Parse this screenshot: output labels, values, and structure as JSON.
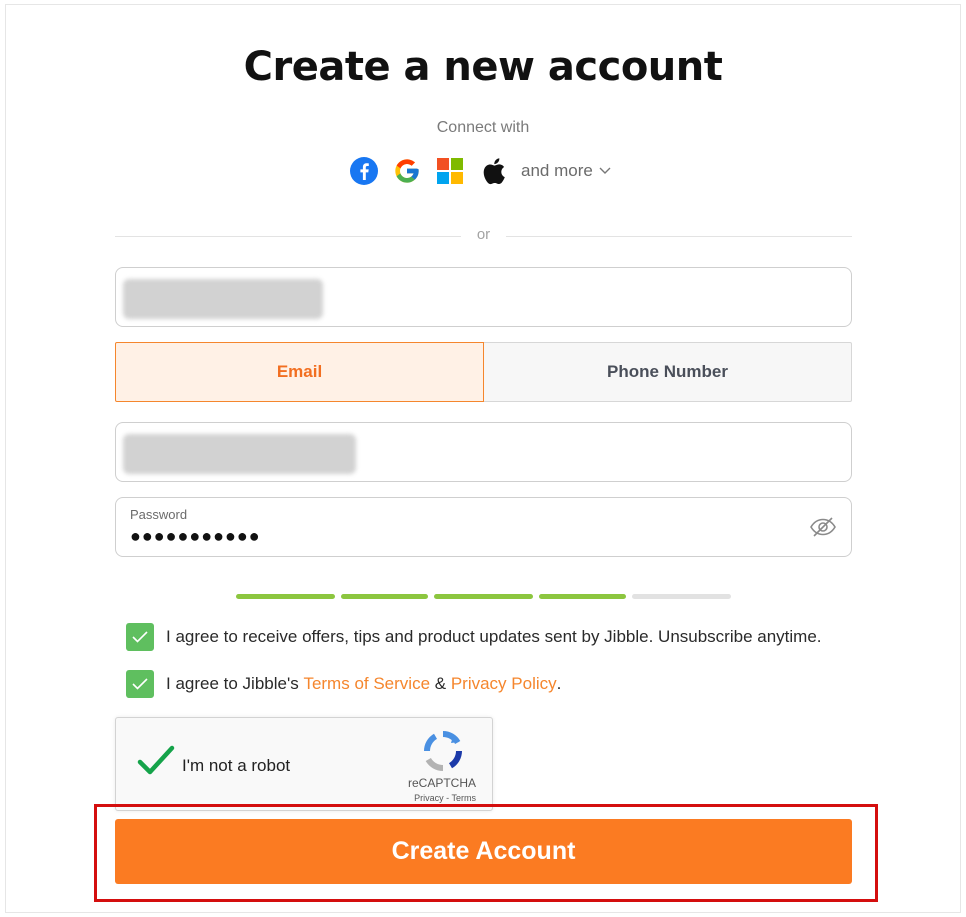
{
  "title": "Create a new account",
  "connect_label": "Connect with",
  "social": {
    "providers": [
      "facebook-icon",
      "google-icon",
      "microsoft-icon",
      "apple-icon"
    ],
    "more_label": "and more"
  },
  "divider_label": "or",
  "form": {
    "name_value_redacted": true,
    "tabs": {
      "email_label": "Email",
      "phone_label": "Phone Number",
      "selected": "Email"
    },
    "identifier_value_redacted": true,
    "password": {
      "label": "Password",
      "value": "●●●●●●●●●●●"
    },
    "strength": {
      "filled": 4,
      "total": 5
    },
    "offers_consent": {
      "checked": true,
      "text": "I agree to receive offers, tips and product updates sent by Jibble. Unsubscribe anytime."
    },
    "terms_consent": {
      "checked": true,
      "prefix": "I agree to Jibble's ",
      "terms_label": "Terms of Service",
      "and": " & ",
      "privacy_label": "Privacy Policy",
      "suffix": "."
    }
  },
  "captcha": {
    "label": "I'm not a robot",
    "brand": "reCAPTCHA",
    "privacy": "Privacy",
    "sep": " - ",
    "terms": "Terms",
    "checked": true
  },
  "submit_label": "Create Account",
  "colors": {
    "accent": "#fb7b22",
    "link": "#f5862d",
    "check": "#5fbf5f",
    "strength": "#8cc63f",
    "highlight": "#d40e0e"
  }
}
